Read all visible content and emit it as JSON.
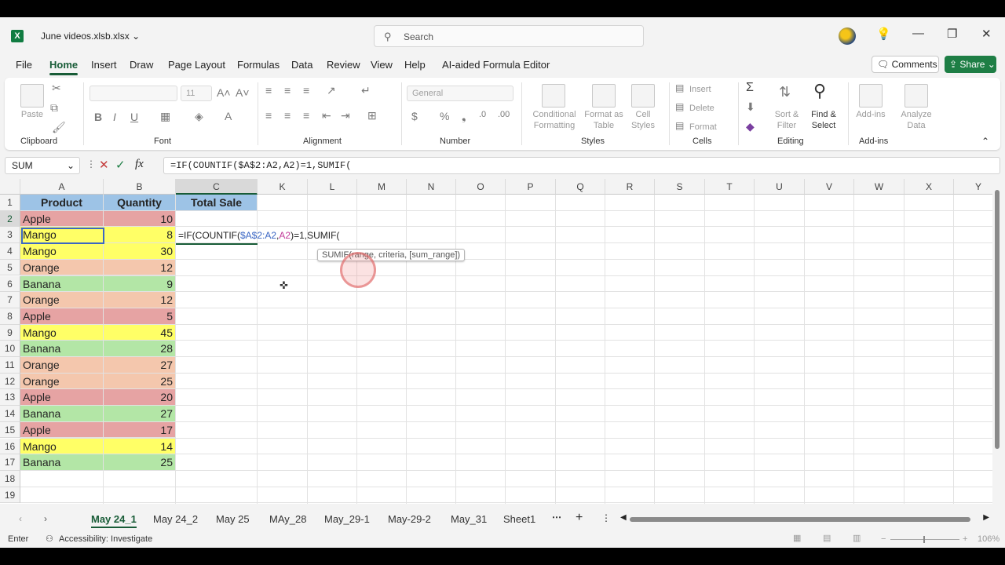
{
  "title": {
    "filename": "June videos.xlsb.xlsx",
    "search_placeholder": "Search"
  },
  "menu": [
    "File",
    "Home",
    "Insert",
    "Draw",
    "Page Layout",
    "Formulas",
    "Data",
    "Review",
    "View",
    "Help",
    "AI-aided Formula Editor"
  ],
  "menu_active": "Home",
  "buttons": {
    "comments": "Comments",
    "share": "Share"
  },
  "ribbon": {
    "clipboard": {
      "label": "Clipboard",
      "paste": "Paste"
    },
    "font": {
      "label": "Font",
      "font_size": "11"
    },
    "alignment": {
      "label": "Alignment"
    },
    "number": {
      "label": "Number",
      "format": "General"
    },
    "styles": {
      "label": "Styles",
      "conditional": "Conditional\nFormatting",
      "format_table": "Format as\nTable",
      "cell_styles": "Cell\nStyles"
    },
    "cells": {
      "label": "Cells",
      "insert": "Insert",
      "delete": "Delete",
      "format": "Format"
    },
    "editing": {
      "label": "Editing",
      "sort": "Sort &\nFilter",
      "find": "Find &\nSelect"
    },
    "addins": {
      "label": "Add-ins",
      "addins": "Add-ins",
      "analyze": "Analyze\nData"
    }
  },
  "formula_bar": {
    "name_box": "SUM",
    "formula": "=IF(COUNTIF($A$2:A2,A2)=1,SUMIF("
  },
  "columns": [
    "A",
    "B",
    "C",
    "K",
    "L",
    "M",
    "N",
    "O",
    "P",
    "Q",
    "R",
    "S",
    "T",
    "U",
    "V",
    "W",
    "X",
    "Y"
  ],
  "headers": {
    "product": "Product",
    "quantity": "Quantity",
    "total": "Total Sale"
  },
  "rows": [
    {
      "product": "Apple",
      "qty": "10",
      "color": "#e6a3a3"
    },
    {
      "product": "Mango",
      "qty": "8",
      "color": "#ffff66"
    },
    {
      "product": "Mango",
      "qty": "30",
      "color": "#ffff66"
    },
    {
      "product": "Orange",
      "qty": "12",
      "color": "#f4c7ad"
    },
    {
      "product": "Banana",
      "qty": "9",
      "color": "#b3e6a6"
    },
    {
      "product": "Orange",
      "qty": "12",
      "color": "#f4c7ad"
    },
    {
      "product": "Apple",
      "qty": "5",
      "color": "#e6a3a3"
    },
    {
      "product": "Mango",
      "qty": "45",
      "color": "#ffff66"
    },
    {
      "product": "Banana",
      "qty": "28",
      "color": "#b3e6a6"
    },
    {
      "product": "Orange",
      "qty": "27",
      "color": "#f4c7ad"
    },
    {
      "product": "Orange",
      "qty": "25",
      "color": "#f4c7ad"
    },
    {
      "product": "Apple",
      "qty": "20",
      "color": "#e6a3a3"
    },
    {
      "product": "Banana",
      "qty": "27",
      "color": "#b3e6a6"
    },
    {
      "product": "Apple",
      "qty": "17",
      "color": "#e6a3a3"
    },
    {
      "product": "Mango",
      "qty": "14",
      "color": "#ffff66"
    },
    {
      "product": "Banana",
      "qty": "25",
      "color": "#b3e6a6"
    }
  ],
  "row_numbers": [
    "1",
    "2",
    "3",
    "4",
    "5",
    "6",
    "7",
    "8",
    "9",
    "10",
    "11",
    "12",
    "13",
    "14",
    "15",
    "16",
    "17",
    "18",
    "19"
  ],
  "active_cell": {
    "formula_pre": "=IF(COUNTIF(",
    "formula_ref": "$A$2:A2",
    "formula_mid": ",",
    "formula_ref2": "A2",
    "formula_post": ")=1,SUMIF(",
    "tooltip": "SUMIF(range, criteria, [sum_range])"
  },
  "sheets": [
    "May 24_1",
    "May 24_2",
    "May 25",
    "MAy_28",
    "May_29-1",
    "May-29-2",
    "May_31",
    "Sheet1"
  ],
  "status": {
    "mode": "Enter",
    "accessibility": "Accessibility: Investigate",
    "zoom": "106%"
  },
  "colors": {
    "header_fill": "#9dc3e6",
    "accent": "#185c37",
    "share": "#1e7e45"
  }
}
